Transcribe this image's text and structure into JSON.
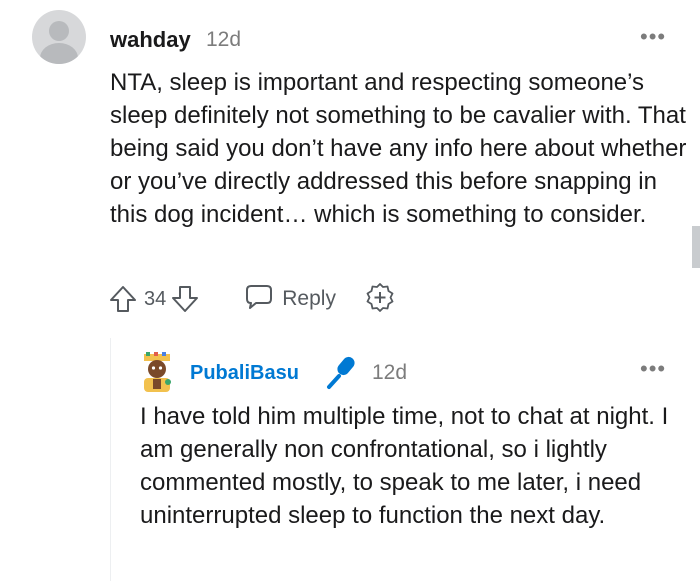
{
  "comment": {
    "username": "wahday",
    "age": "12d",
    "more_label": "•••",
    "body": "NTA, sleep is important and respecting someone’s sleep definitely not something to be cavalier with. That being said you don’t have any info here about whether or you’ve directly addressed this before snapping in this dog incident… which is something to consider.",
    "score": "34",
    "reply_label": "Reply",
    "icons": [
      "avatar-placeholder",
      "upvote-icon",
      "downvote-icon",
      "reply-bubble-icon",
      "award-plus-icon",
      "more-options-icon"
    ]
  },
  "reply": {
    "username": "PubaliBasu",
    "age": "12d",
    "more_label": "•••",
    "body": "I have told him multiple time, not to chat at night. I am generally non confrontational, so i lightly commented mostly, to speak to me later, i need uninterrupted sleep to function the next day.",
    "icons": [
      "avatar-icon",
      "microphone-icon",
      "more-options-icon"
    ]
  },
  "colors": {
    "text": "#1a1a1b",
    "meta": "#7c7c7c",
    "action": "#555a5f",
    "reply_username": "#0079d3",
    "mic": "#0079d3"
  }
}
